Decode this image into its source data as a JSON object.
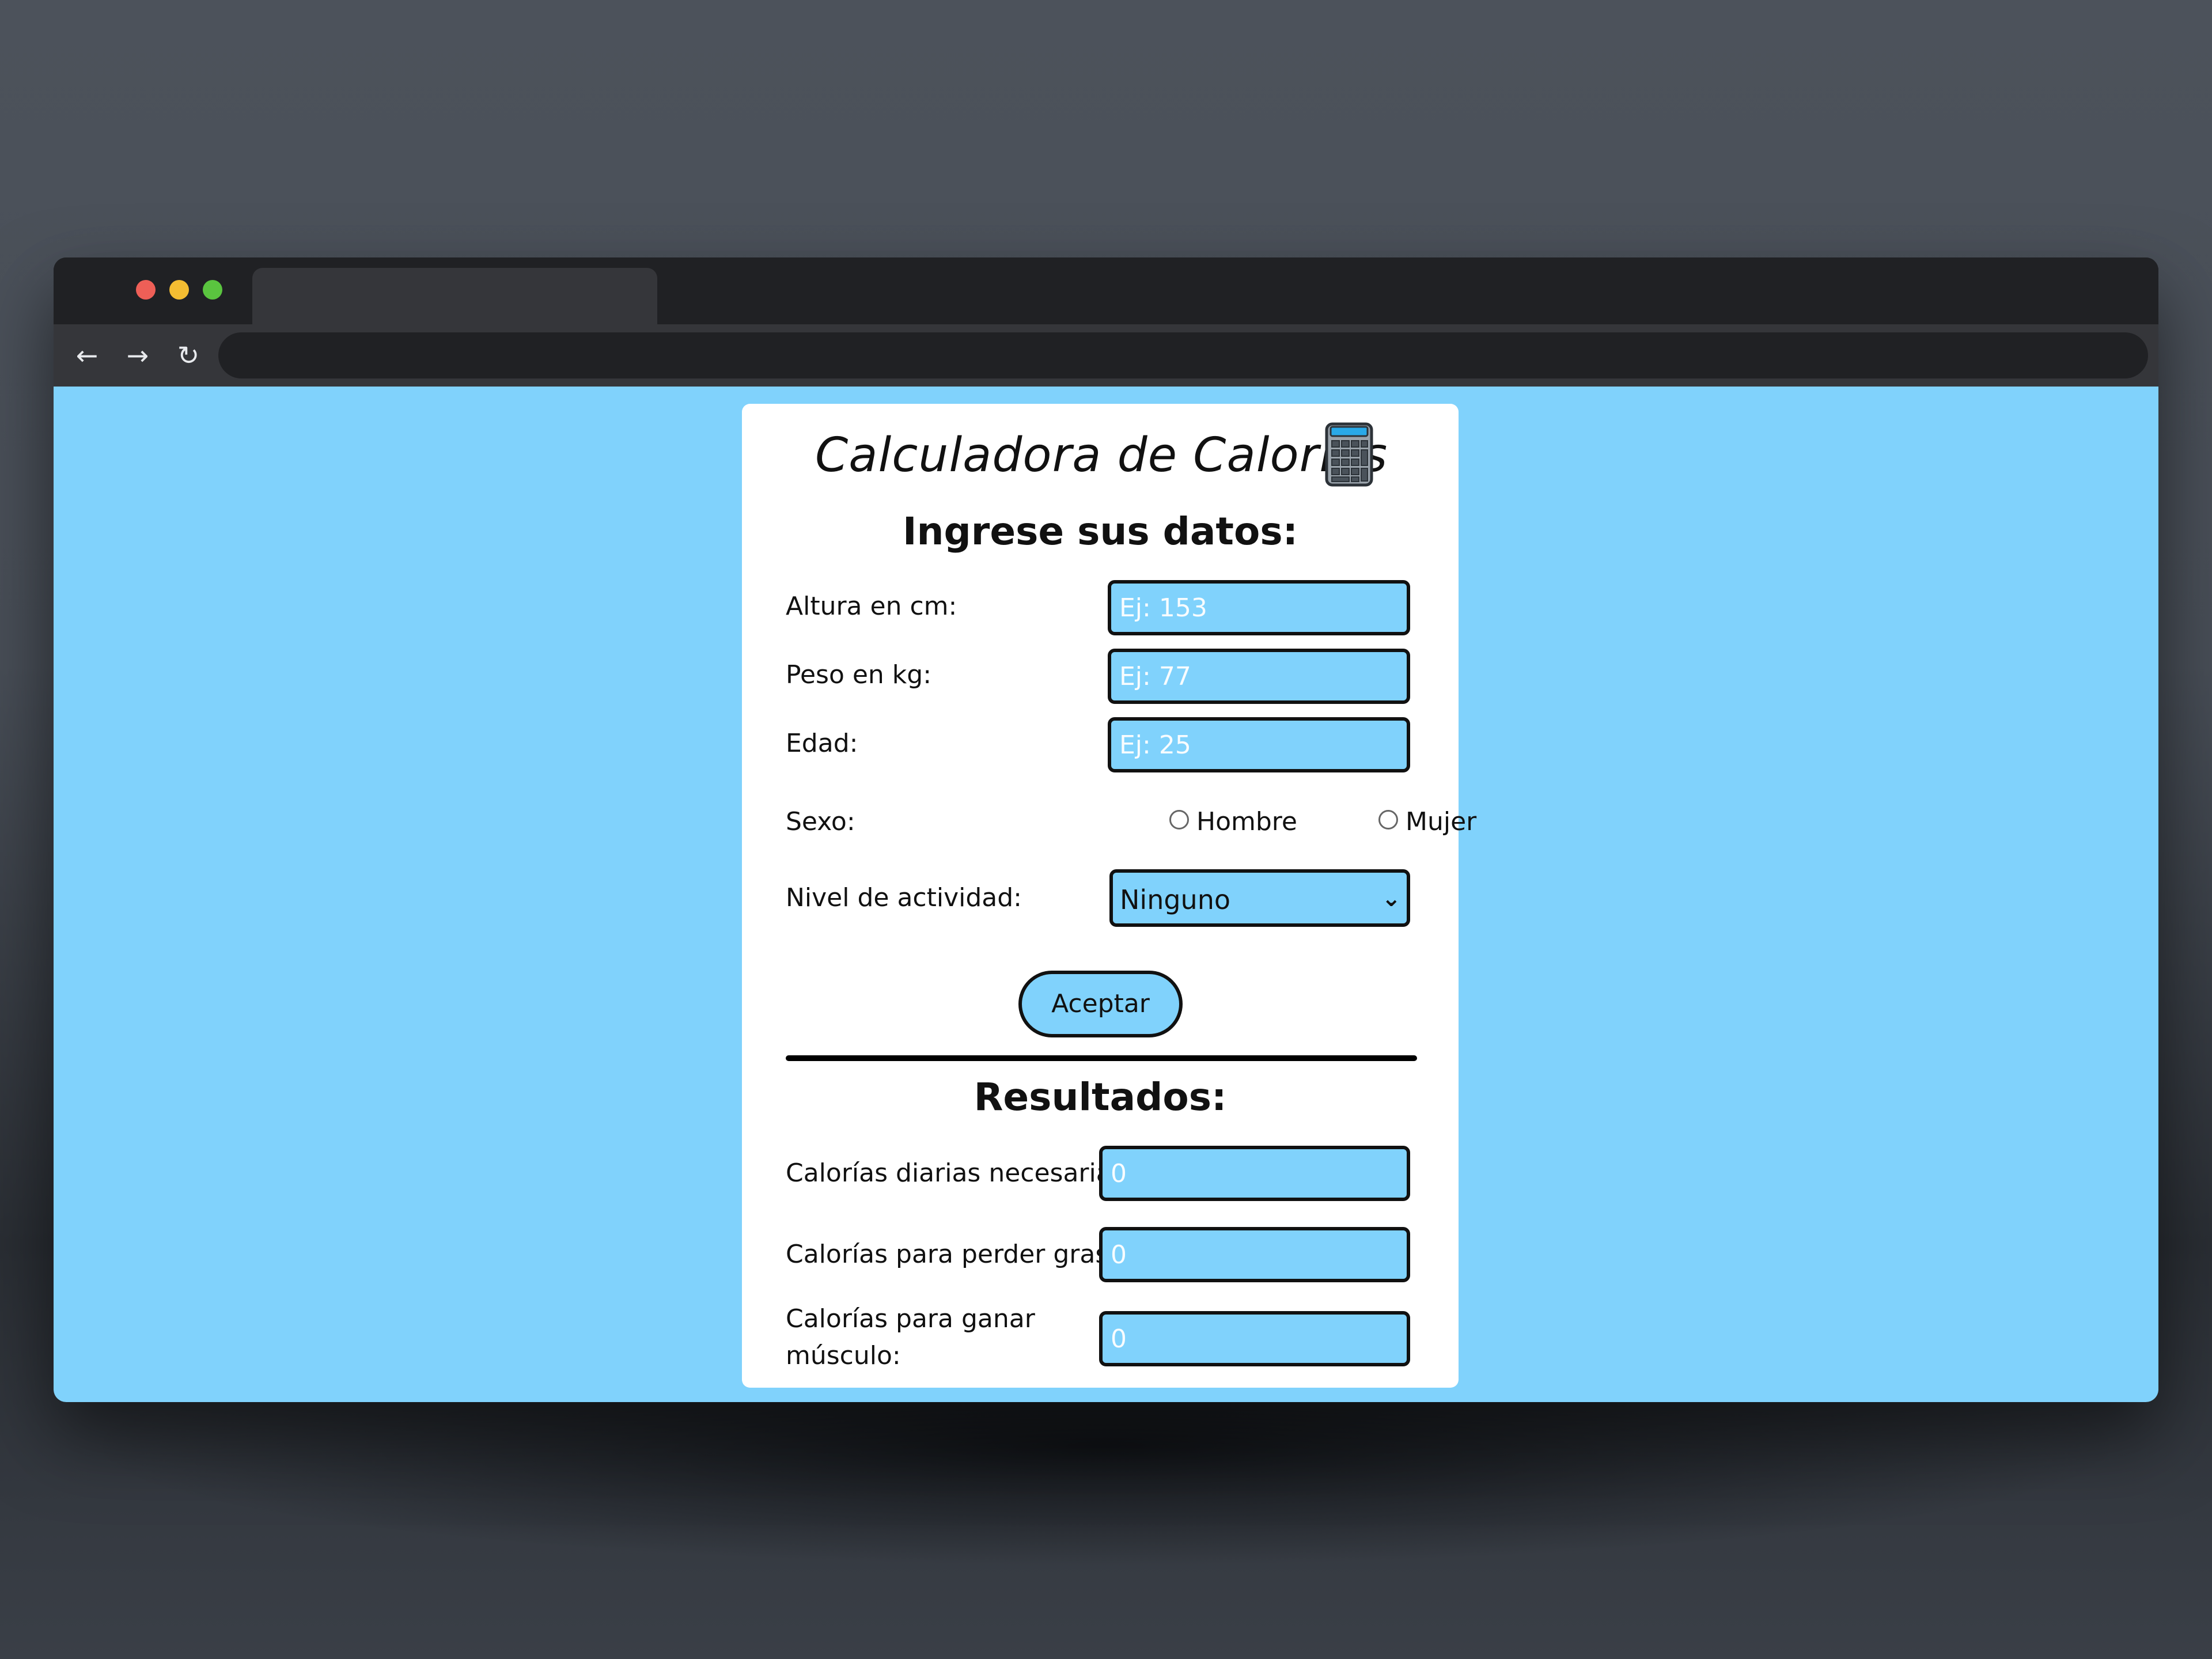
{
  "browser": {
    "tab_title": "",
    "url": ""
  },
  "app": {
    "title": "Calculadora de Calorías",
    "icon": "calculator-icon",
    "input_heading": "Ingrese sus datos:",
    "fields": {
      "height_label": "Altura en cm:",
      "height_placeholder": "Ej: 153",
      "weight_label": "Peso en kg:",
      "weight_placeholder": "Ej: 77",
      "age_label": "Edad:",
      "age_placeholder": "Ej: 25",
      "sex_label": "Sexo:",
      "sex_options": [
        "Hombre",
        "Mujer"
      ],
      "activity_label": "Nivel de actividad:",
      "activity_selected": "Ninguno"
    },
    "accept_label": "Aceptar",
    "results_heading": "Resultados:",
    "results": {
      "daily_label": "Calorías diarias necesarias:",
      "daily_value": "0",
      "lose_fat_label": "Calorías para perder grasa:",
      "lose_fat_value": "0",
      "gain_muscle_label_line1": "Calorías para ganar",
      "gain_muscle_label_line2": "músculo:",
      "gain_muscle_value": "0"
    }
  },
  "colors": {
    "page_background": "#80d2fc",
    "card_background": "#ffffff",
    "input_background": "#80d2fc",
    "border": "#111111"
  }
}
